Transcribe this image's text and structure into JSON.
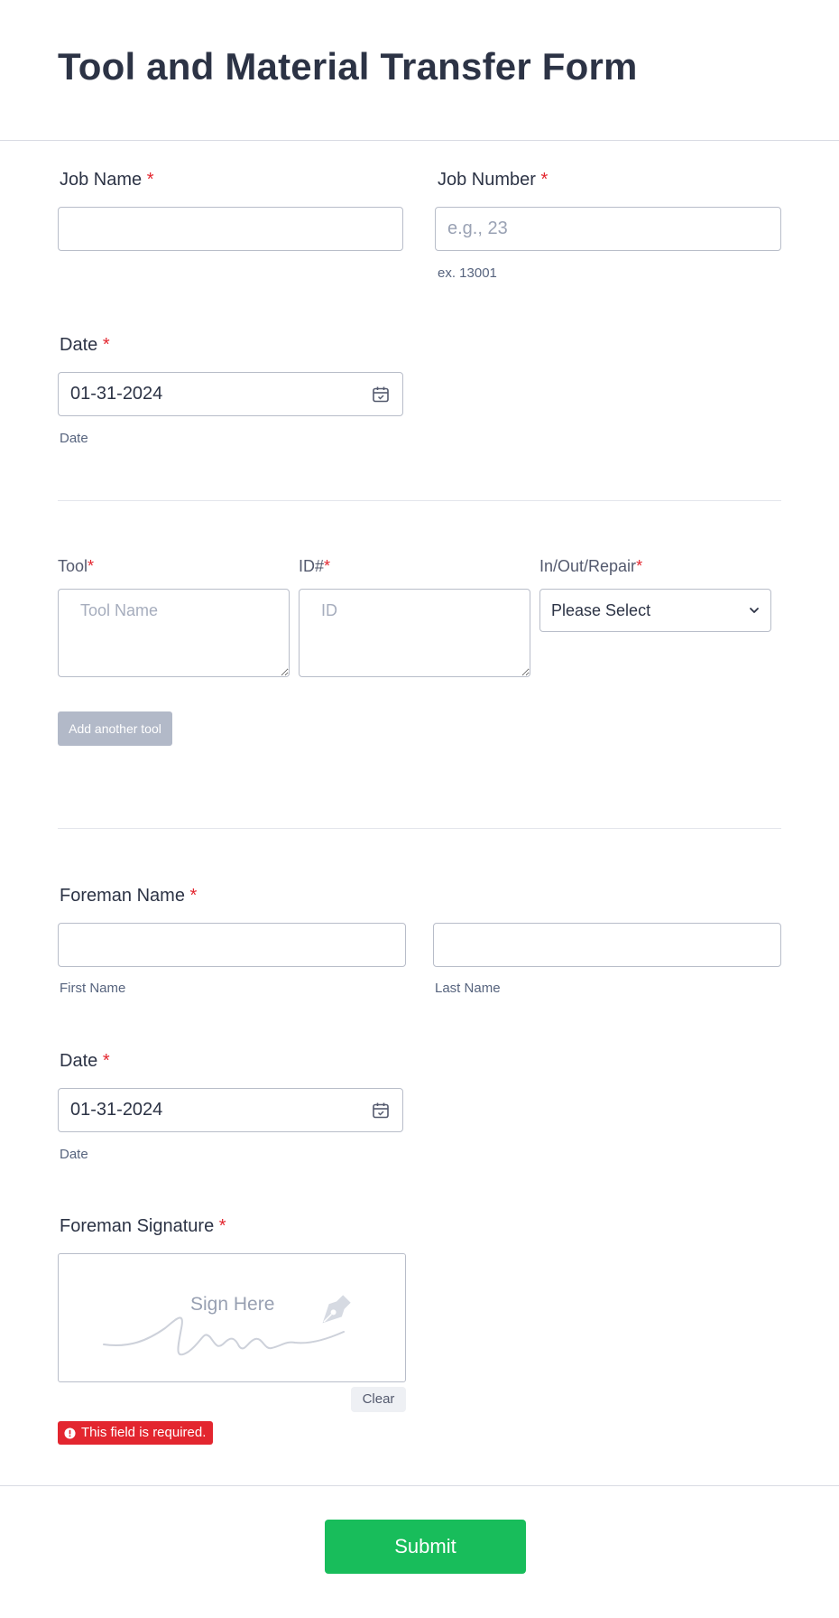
{
  "form": {
    "title": "Tool and Material Transfer Form"
  },
  "job_name": {
    "label": "Job Name",
    "required_mark": "*",
    "value": ""
  },
  "job_number": {
    "label": "Job Number",
    "required_mark": "*",
    "placeholder": "e.g., 23",
    "sublabel": "ex. 13001"
  },
  "date1": {
    "label": "Date",
    "required_mark": "*",
    "value": "01-31-2024",
    "sublabel": "Date"
  },
  "tools": {
    "tool_label": "Tool",
    "id_label": "ID#",
    "status_label": "In/Out/Repair",
    "required_mark": "*",
    "tool_placeholder": "Tool Name",
    "id_placeholder": "ID",
    "status_value": "Please Select",
    "add_button": "Add another tool"
  },
  "foreman_name": {
    "label": "Foreman Name",
    "required_mark": "*",
    "first_sublabel": "First Name",
    "last_sublabel": "Last Name"
  },
  "date2": {
    "label": "Date",
    "required_mark": "*",
    "value": "01-31-2024",
    "sublabel": "Date"
  },
  "signature": {
    "label": "Foreman Signature",
    "required_mark": "*",
    "placeholder": "Sign Here",
    "clear_button": "Clear",
    "error": "This field is required."
  },
  "submit": {
    "label": "Submit",
    "color": "#18bd5b"
  },
  "colors": {
    "required": "#e3262f",
    "text": "#2c3345",
    "error_bg": "#e3262f"
  }
}
